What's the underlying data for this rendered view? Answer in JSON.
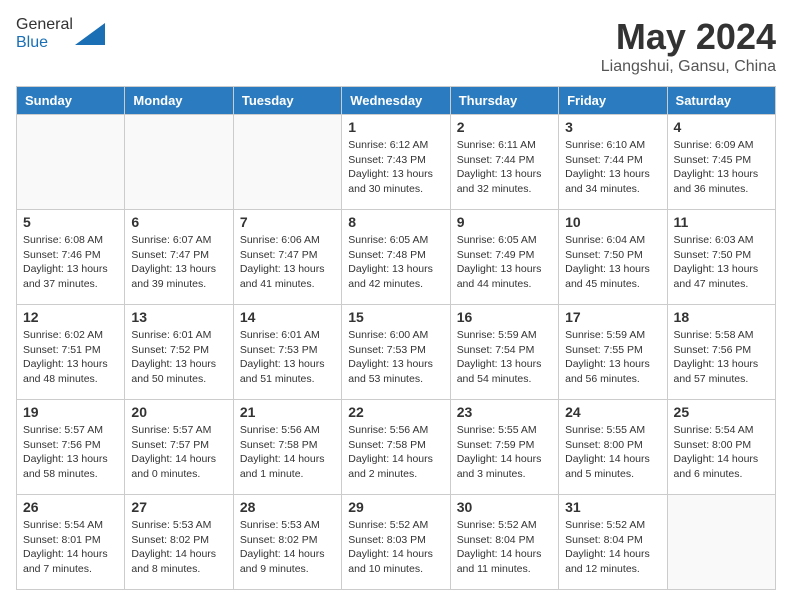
{
  "header": {
    "logo_general": "General",
    "logo_blue": "Blue",
    "month_year": "May 2024",
    "location": "Liangshui, Gansu, China"
  },
  "days_of_week": [
    "Sunday",
    "Monday",
    "Tuesday",
    "Wednesday",
    "Thursday",
    "Friday",
    "Saturday"
  ],
  "weeks": [
    [
      {
        "day": "",
        "info": ""
      },
      {
        "day": "",
        "info": ""
      },
      {
        "day": "",
        "info": ""
      },
      {
        "day": "1",
        "info": "Sunrise: 6:12 AM\nSunset: 7:43 PM\nDaylight: 13 hours\nand 30 minutes."
      },
      {
        "day": "2",
        "info": "Sunrise: 6:11 AM\nSunset: 7:44 PM\nDaylight: 13 hours\nand 32 minutes."
      },
      {
        "day": "3",
        "info": "Sunrise: 6:10 AM\nSunset: 7:44 PM\nDaylight: 13 hours\nand 34 minutes."
      },
      {
        "day": "4",
        "info": "Sunrise: 6:09 AM\nSunset: 7:45 PM\nDaylight: 13 hours\nand 36 minutes."
      }
    ],
    [
      {
        "day": "5",
        "info": "Sunrise: 6:08 AM\nSunset: 7:46 PM\nDaylight: 13 hours\nand 37 minutes."
      },
      {
        "day": "6",
        "info": "Sunrise: 6:07 AM\nSunset: 7:47 PM\nDaylight: 13 hours\nand 39 minutes."
      },
      {
        "day": "7",
        "info": "Sunrise: 6:06 AM\nSunset: 7:47 PM\nDaylight: 13 hours\nand 41 minutes."
      },
      {
        "day": "8",
        "info": "Sunrise: 6:05 AM\nSunset: 7:48 PM\nDaylight: 13 hours\nand 42 minutes."
      },
      {
        "day": "9",
        "info": "Sunrise: 6:05 AM\nSunset: 7:49 PM\nDaylight: 13 hours\nand 44 minutes."
      },
      {
        "day": "10",
        "info": "Sunrise: 6:04 AM\nSunset: 7:50 PM\nDaylight: 13 hours\nand 45 minutes."
      },
      {
        "day": "11",
        "info": "Sunrise: 6:03 AM\nSunset: 7:50 PM\nDaylight: 13 hours\nand 47 minutes."
      }
    ],
    [
      {
        "day": "12",
        "info": "Sunrise: 6:02 AM\nSunset: 7:51 PM\nDaylight: 13 hours\nand 48 minutes."
      },
      {
        "day": "13",
        "info": "Sunrise: 6:01 AM\nSunset: 7:52 PM\nDaylight: 13 hours\nand 50 minutes."
      },
      {
        "day": "14",
        "info": "Sunrise: 6:01 AM\nSunset: 7:53 PM\nDaylight: 13 hours\nand 51 minutes."
      },
      {
        "day": "15",
        "info": "Sunrise: 6:00 AM\nSunset: 7:53 PM\nDaylight: 13 hours\nand 53 minutes."
      },
      {
        "day": "16",
        "info": "Sunrise: 5:59 AM\nSunset: 7:54 PM\nDaylight: 13 hours\nand 54 minutes."
      },
      {
        "day": "17",
        "info": "Sunrise: 5:59 AM\nSunset: 7:55 PM\nDaylight: 13 hours\nand 56 minutes."
      },
      {
        "day": "18",
        "info": "Sunrise: 5:58 AM\nSunset: 7:56 PM\nDaylight: 13 hours\nand 57 minutes."
      }
    ],
    [
      {
        "day": "19",
        "info": "Sunrise: 5:57 AM\nSunset: 7:56 PM\nDaylight: 13 hours\nand 58 minutes."
      },
      {
        "day": "20",
        "info": "Sunrise: 5:57 AM\nSunset: 7:57 PM\nDaylight: 14 hours\nand 0 minutes."
      },
      {
        "day": "21",
        "info": "Sunrise: 5:56 AM\nSunset: 7:58 PM\nDaylight: 14 hours\nand 1 minute."
      },
      {
        "day": "22",
        "info": "Sunrise: 5:56 AM\nSunset: 7:58 PM\nDaylight: 14 hours\nand 2 minutes."
      },
      {
        "day": "23",
        "info": "Sunrise: 5:55 AM\nSunset: 7:59 PM\nDaylight: 14 hours\nand 3 minutes."
      },
      {
        "day": "24",
        "info": "Sunrise: 5:55 AM\nSunset: 8:00 PM\nDaylight: 14 hours\nand 5 minutes."
      },
      {
        "day": "25",
        "info": "Sunrise: 5:54 AM\nSunset: 8:00 PM\nDaylight: 14 hours\nand 6 minutes."
      }
    ],
    [
      {
        "day": "26",
        "info": "Sunrise: 5:54 AM\nSunset: 8:01 PM\nDaylight: 14 hours\nand 7 minutes."
      },
      {
        "day": "27",
        "info": "Sunrise: 5:53 AM\nSunset: 8:02 PM\nDaylight: 14 hours\nand 8 minutes."
      },
      {
        "day": "28",
        "info": "Sunrise: 5:53 AM\nSunset: 8:02 PM\nDaylight: 14 hours\nand 9 minutes."
      },
      {
        "day": "29",
        "info": "Sunrise: 5:52 AM\nSunset: 8:03 PM\nDaylight: 14 hours\nand 10 minutes."
      },
      {
        "day": "30",
        "info": "Sunrise: 5:52 AM\nSunset: 8:04 PM\nDaylight: 14 hours\nand 11 minutes."
      },
      {
        "day": "31",
        "info": "Sunrise: 5:52 AM\nSunset: 8:04 PM\nDaylight: 14 hours\nand 12 minutes."
      },
      {
        "day": "",
        "info": ""
      }
    ]
  ]
}
